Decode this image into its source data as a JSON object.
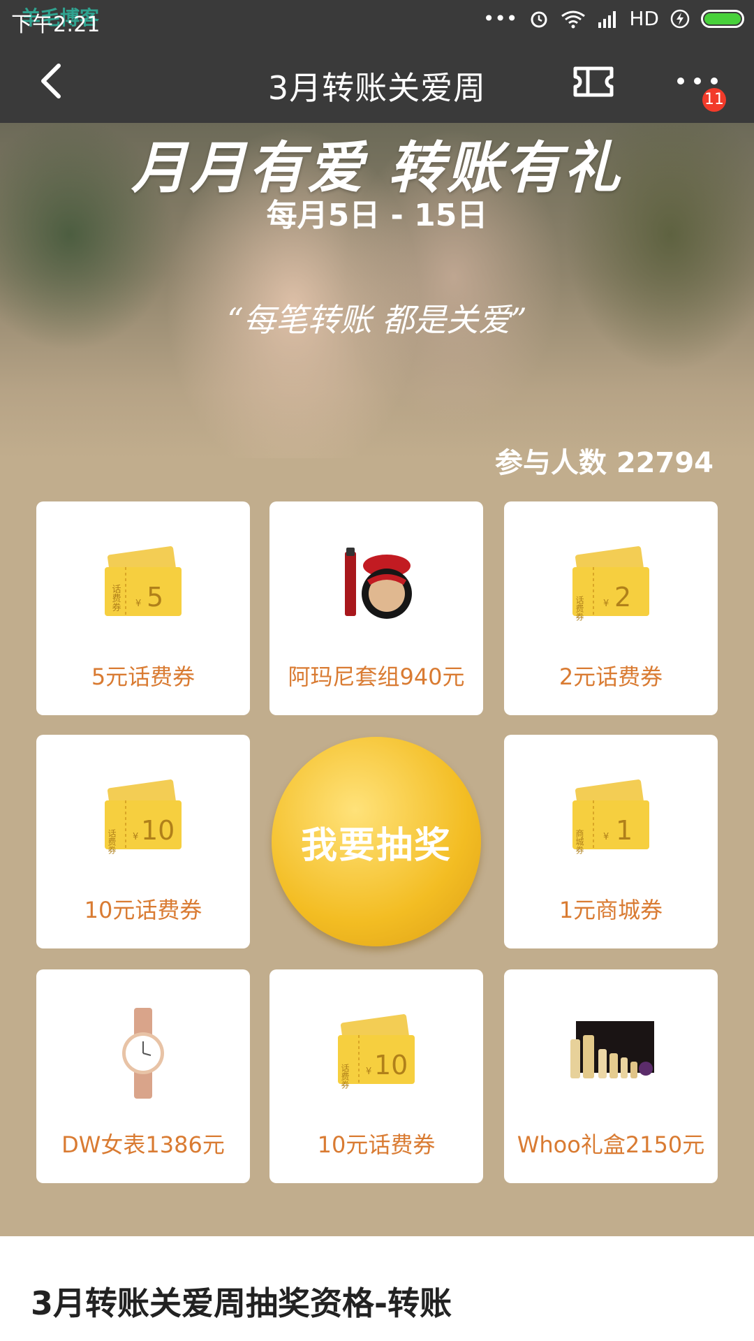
{
  "status_bar": {
    "time": "下午2:21",
    "network": "HD",
    "watermark": "羊毛博客",
    "watermark_url": "zzzzzz.me"
  },
  "topbar": {
    "title": "3月转账关爱周",
    "badge_count": "11"
  },
  "hero": {
    "headline": "月月有爱  转账有礼",
    "date_range": "每月5日 - 15日",
    "quote": "“每笔转账  都是关爱”"
  },
  "participants": {
    "label": "参与人数 22794"
  },
  "prizes": [
    {
      "label": "5元话费券",
      "icon": "phone-credit-voucher-icon",
      "voucher_tag": "话费券",
      "amount": "5"
    },
    {
      "label": "阿玛尼套组940元",
      "icon": "armani-makeup-set-icon"
    },
    {
      "label": "2元话费券",
      "icon": "phone-credit-voucher-icon",
      "voucher_tag": "话费券",
      "amount": "2"
    },
    {
      "label": "10元话费券",
      "icon": "phone-credit-voucher-icon",
      "voucher_tag": "话费券",
      "amount": "10"
    },
    {
      "label": "1元商城券",
      "icon": "mall-voucher-icon",
      "voucher_tag": "商城券",
      "amount": "1"
    },
    {
      "label": "DW女表1386元",
      "icon": "dw-watch-icon"
    },
    {
      "label": "10元话费券",
      "icon": "phone-credit-voucher-icon",
      "voucher_tag": "话费券",
      "amount": "10"
    },
    {
      "label": "Whoo礼盒2150元",
      "icon": "whoo-gift-box-icon"
    }
  ],
  "draw_button": {
    "label": "我要抽奖"
  },
  "bottom": {
    "title": "3月转账关爱周抽奖资格-转账"
  },
  "colors": {
    "accent": "#d97b32",
    "background": "#c1ad8d",
    "gold": "#f3bd23"
  }
}
